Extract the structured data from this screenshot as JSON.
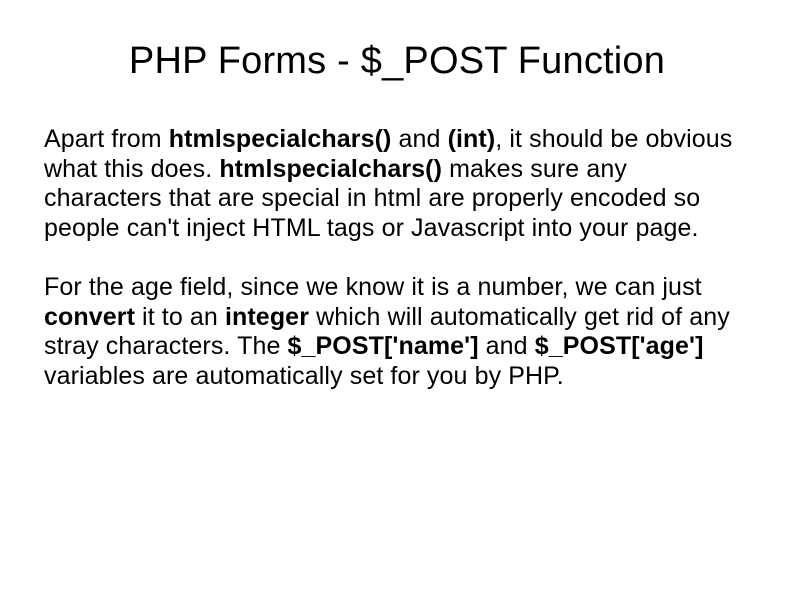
{
  "title": "PHP Forms - $_POST Function",
  "p1": {
    "t1": "Apart from ",
    "b1": "htmlspecialchars()",
    "t2": " and ",
    "b2": "(int)",
    "t3": ", it should be obvious what this does. ",
    "b3": "htmlspecialchars()",
    "t4": " makes sure any characters that are special in html are properly encoded so people can't inject HTML tags or Javascript into your page."
  },
  "p2": {
    "t1": "For the age field, since we know it is a number, we can just ",
    "b1": "convert",
    "t2": " it to an ",
    "b2": "integer",
    "t3": " which will automatically get rid of any stray characters. The ",
    "b3": "$_POST['name']",
    "t4": " and ",
    "b4": "$_POST['age']",
    "t5": "  variables are automatically set for you by PHP."
  }
}
